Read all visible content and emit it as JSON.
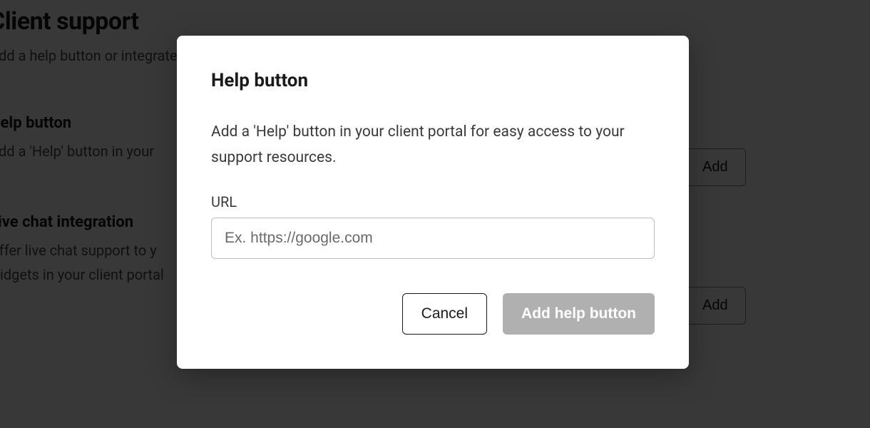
{
  "page": {
    "title": "Client support",
    "subtitle": "Add a help button or integrate"
  },
  "sections": [
    {
      "title": "Help button",
      "desc": "Add a 'Help' button in your",
      "button_label": "Add"
    },
    {
      "title": "Live chat integration",
      "desc_line1": "Offer live chat support to y",
      "desc_line2": "widgets in your client portal",
      "button_label": "Add"
    }
  ],
  "modal": {
    "title": "Help button",
    "description": "Add a 'Help' button in your client portal for easy access to your support resources.",
    "url_label": "URL",
    "url_placeholder": "Ex. https://google.com",
    "cancel_label": "Cancel",
    "submit_label": "Add help button"
  }
}
